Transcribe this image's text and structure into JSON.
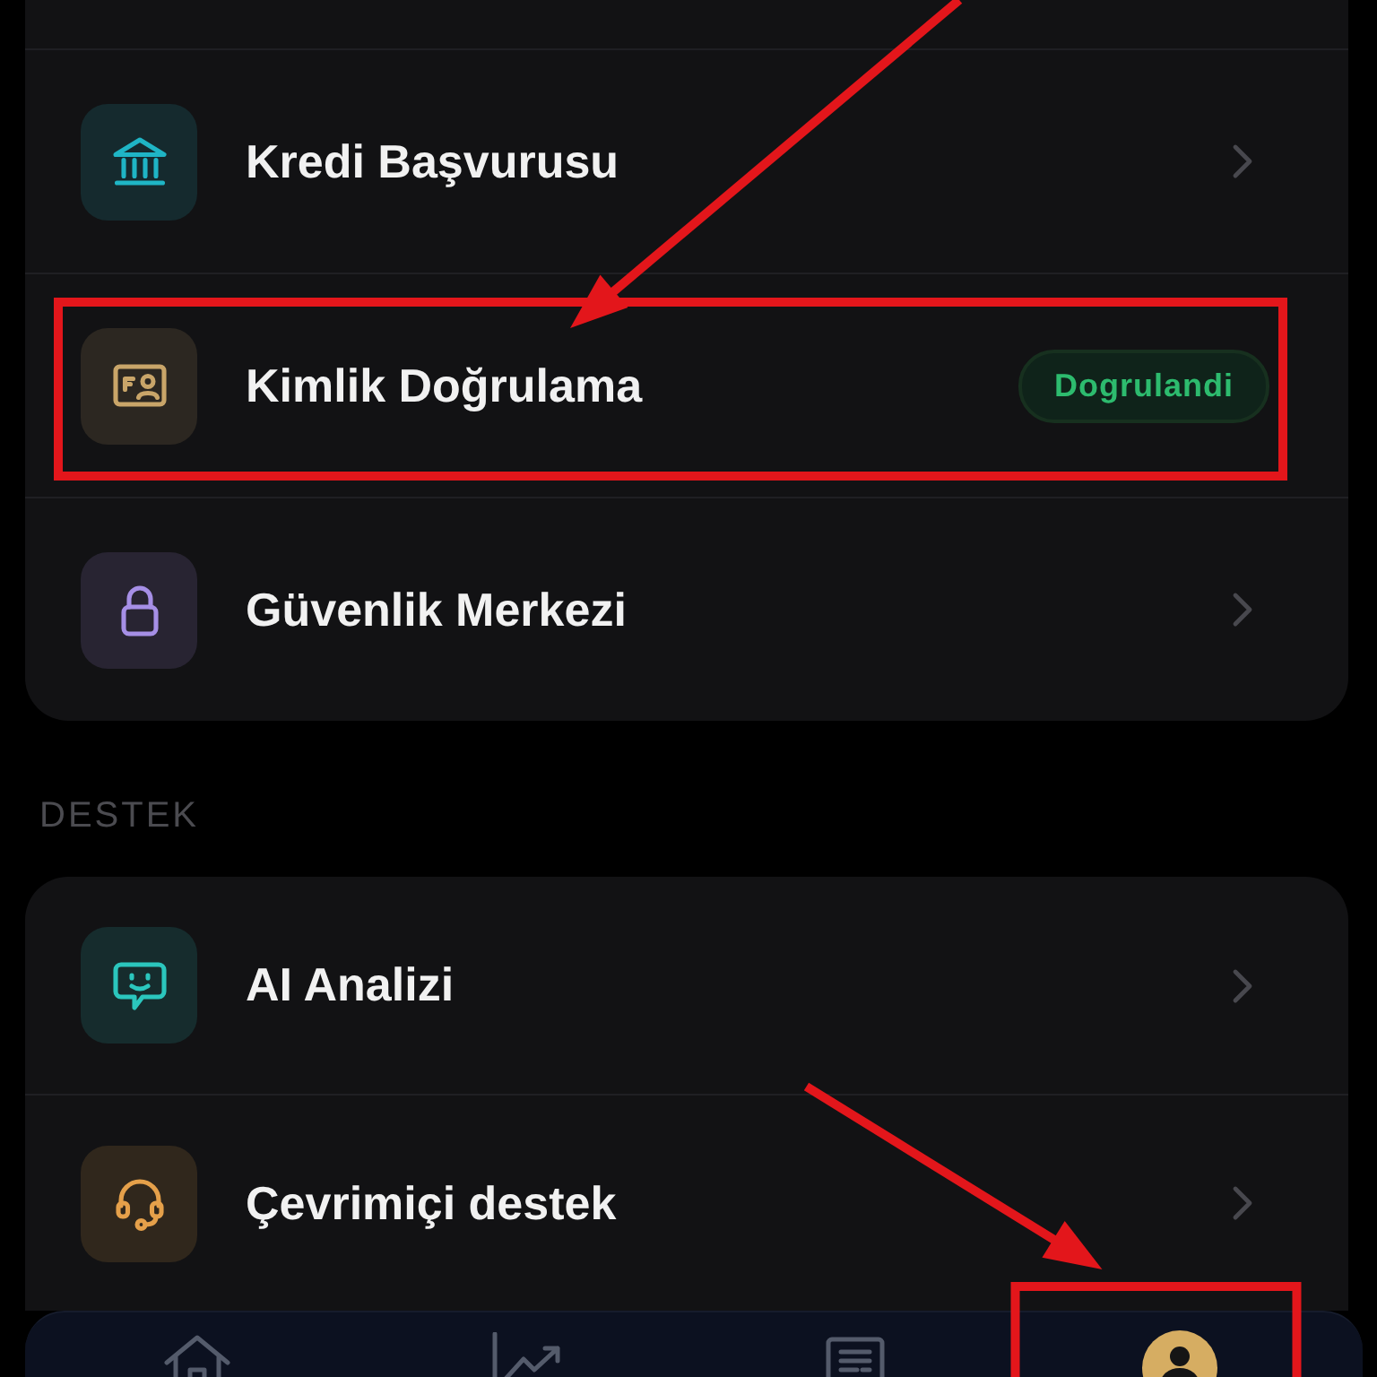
{
  "sections": [
    {
      "rows": [
        {
          "label": "Kredi Başvurusu",
          "kind": "link",
          "color": "#1fb5c5",
          "highlighted": false
        },
        {
          "label": "Kimlik Doğrulama",
          "kind": "status",
          "badge": "Dogrulandi",
          "color": "#c9a569",
          "highlighted": true
        },
        {
          "label": "Güvenlik Merkezi",
          "kind": "link",
          "color": "#a68fe6",
          "highlighted": false
        }
      ]
    },
    {
      "title": "DESTEK",
      "rows": [
        {
          "label": "AI Analizi",
          "kind": "link",
          "color": "#2bc6bd",
          "highlighted": false
        },
        {
          "label": "Çevrimiçi destek",
          "kind": "link",
          "color": "#e5a04a",
          "highlighted": false
        }
      ]
    }
  ],
  "bottom_nav": [
    {
      "selected": false,
      "highlighted": false
    },
    {
      "selected": false,
      "highlighted": false
    },
    {
      "selected": false,
      "highlighted": false
    },
    {
      "selected": true,
      "highlighted": true
    }
  ]
}
